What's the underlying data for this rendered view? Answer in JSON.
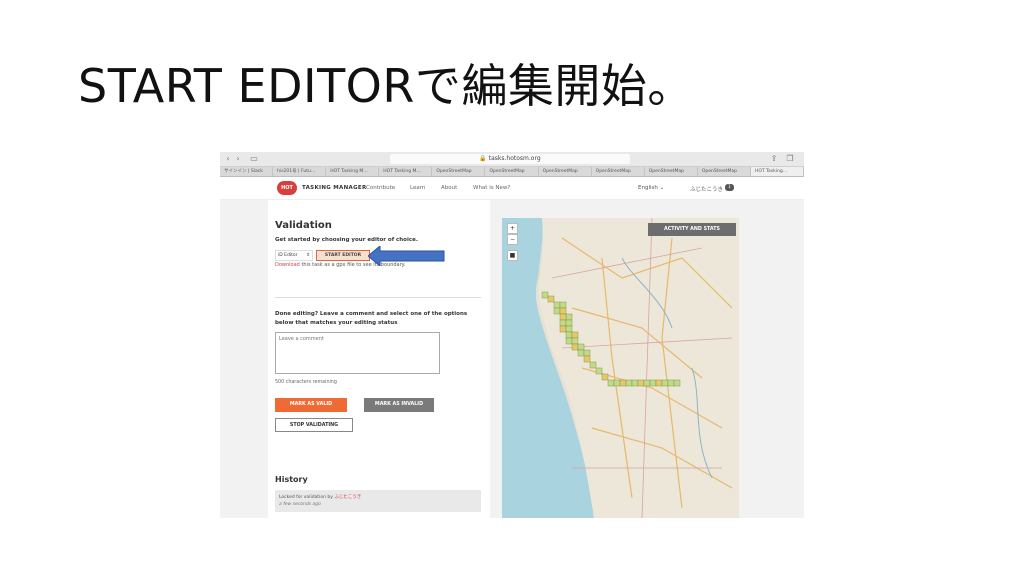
{
  "slide": {
    "title": "START EDITORで編集開始。"
  },
  "browser": {
    "url": "tasks.hotosm.org",
    "tabs": [
      "サインイン | Slack",
      "his201号 | Futu…",
      "HOT Tasking M…",
      "HOT Tasking M…",
      "OpenStreetMap",
      "OpenStreetMap",
      "OpenStreetMap",
      "OpenStreetMap",
      "OpenStreetMap",
      "OpenStreetMap",
      "HOT Tasking…"
    ]
  },
  "header": {
    "logo_text": "TASKING MANAGER",
    "logo_badge": "HOT",
    "nav": [
      "Contribute",
      "Learn",
      "About",
      "What is New?"
    ],
    "language": "English",
    "user": "ふじたこうき",
    "user_badge": "1"
  },
  "validation": {
    "heading": "Validation",
    "subheading": "Get started by choosing your editor of choice.",
    "editor_select": "iD Editor",
    "start_editor": "START EDITOR",
    "download_link": "Download",
    "download_rest": " this task as a gpx file to see its boundary.",
    "done_text": "Done editing? Leave a comment and select one of the options below that matches your editing status",
    "comment_placeholder": "Leave a comment",
    "chars_remaining": "500 characters remaining",
    "mark_valid": "MARK AS VALID",
    "mark_invalid": "MARK AS INVALID",
    "stop_validating": "STOP VALIDATING"
  },
  "history": {
    "heading": "History",
    "entry_prefix": "Locked for validation by ",
    "entry_user": "ふじたこうき",
    "entry_time": "a few seconds ago"
  },
  "map": {
    "activity_button": "ACTIVITY AND STATS",
    "zoom_in": "+",
    "zoom_out": "−"
  },
  "colors": {
    "accent": "#ef6b35",
    "brand_red": "#d73f3f",
    "arrow_blue": "#4472c4"
  }
}
